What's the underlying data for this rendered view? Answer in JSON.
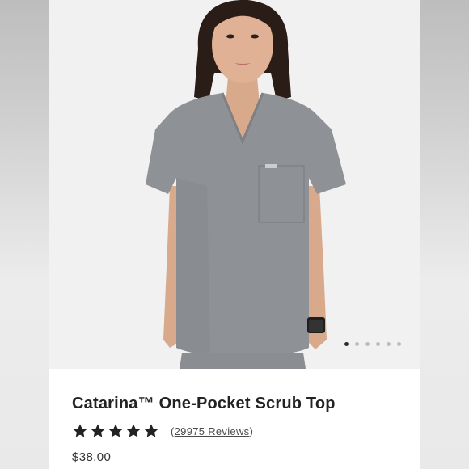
{
  "product": {
    "title": "Catarina™ One-Pocket Scrub Top",
    "rating": {
      "stars": 5,
      "max_stars": 5
    },
    "reviews": {
      "open_paren": "(",
      "link_text": "29975 Reviews",
      "close_paren": ")"
    },
    "price": "$38.00"
  },
  "carousel": {
    "total_images": 6,
    "active_index": 0
  },
  "colors": {
    "scrub": "#8e9196",
    "star": "#222222",
    "dot_active": "#2b2b2b",
    "dot_inactive": "#bdbdbd"
  },
  "icons": {
    "star": "star-icon",
    "product_photo": "scrub-top-photo"
  }
}
